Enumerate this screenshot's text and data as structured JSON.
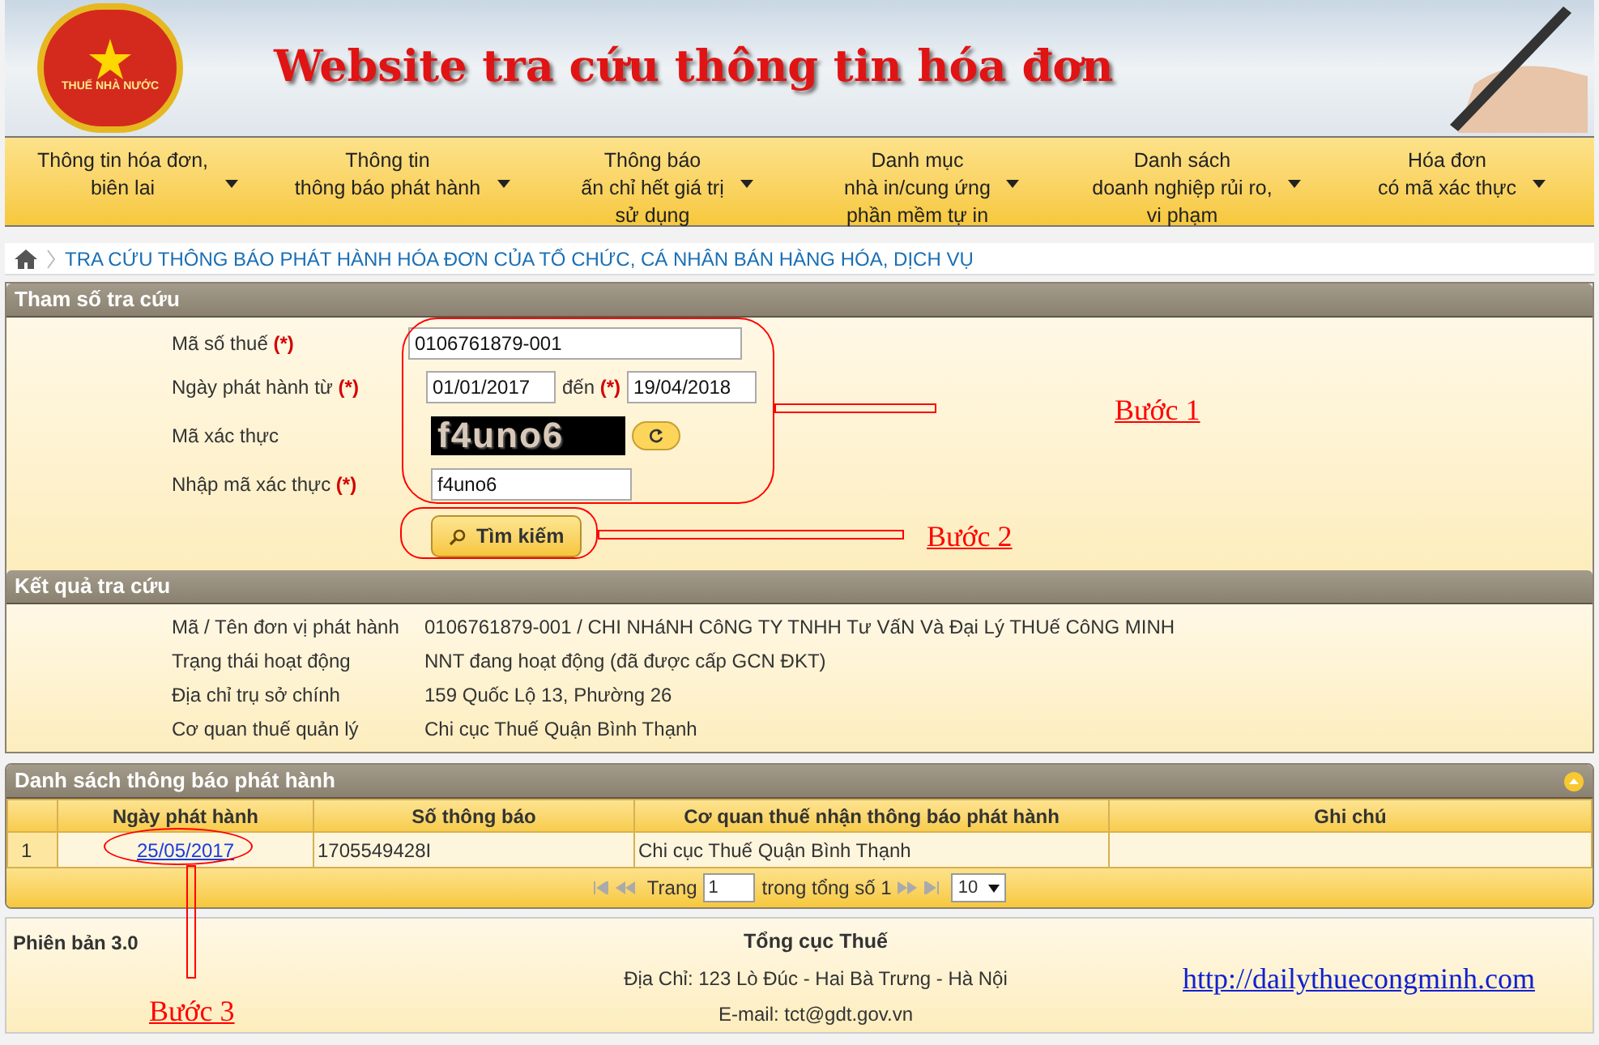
{
  "header": {
    "emblem_text": "THUẾ NHÀ NƯỚC",
    "title": "Website tra cứu thông tin hóa đơn"
  },
  "menu": [
    {
      "lines": [
        "Thông tin hóa đơn,",
        "biên lai"
      ]
    },
    {
      "lines": [
        "Thông tin",
        "thông báo phát hành"
      ]
    },
    {
      "lines": [
        "Thông báo",
        "ấn chỉ hết giá trị",
        "sử dụng"
      ]
    },
    {
      "lines": [
        "Danh mục",
        "nhà in/cung ứng",
        "phần mềm tự in"
      ]
    },
    {
      "lines": [
        "Danh sách",
        "doanh nghiệp rủi ro,",
        "vi phạm"
      ]
    },
    {
      "lines": [
        "Hóa đơn",
        "có mã xác thực"
      ]
    }
  ],
  "breadcrumb": "TRA CỨU THÔNG BÁO PHÁT HÀNH HÓA ĐƠN CỦA TỔ CHỨC, CÁ NHÂN BÁN HÀNG HÓA, DỊCH VỤ",
  "search": {
    "title": "Tham số tra cứu",
    "required_mark": "(*)",
    "tax_code_label": "Mã số thuế",
    "tax_code": "0106761879-001",
    "date_label": "Ngày phát hành từ",
    "date_from": "01/01/2017",
    "to_label": "đến",
    "date_to": "19/04/2018",
    "captcha_label": "Mã xác thực",
    "captcha": "f4uno6",
    "captcha_input_label": "Nhập mã xác thực",
    "captcha_input": "f4uno6",
    "button": "Tìm kiếm"
  },
  "result": {
    "title": "Kết quả tra cứu",
    "rows": [
      {
        "label": "Mã / Tên đơn vị phát hành",
        "value": "0106761879-001 / CHI NHáNH CôNG TY TNHH Tư VấN Và Đại Lý THUế CôNG MINH"
      },
      {
        "label": "Trạng thái hoạt động",
        "value": "NNT đang hoạt động (đã được cấp GCN ĐKT)"
      },
      {
        "label": "Địa chỉ trụ sở chính",
        "value": "159 Quốc Lộ 13, Phường 26"
      },
      {
        "label": "Cơ quan thuế quản lý",
        "value": "Chi cục Thuế Quận Bình Thạnh"
      }
    ]
  },
  "notices": {
    "title": "Danh sách thông báo phát hành",
    "columns": [
      "Ngày phát hành",
      "Số thông báo",
      "Cơ quan thuế nhận thông báo phát hành",
      "Ghi chú"
    ],
    "rows": [
      {
        "index": "1",
        "date": "25/05/2017",
        "number": "1705549428I",
        "agency": "Chi cục Thuế Quận Bình Thạnh"
      }
    ],
    "pager": {
      "page_label": "Trang",
      "page": "1",
      "total_label": "trong tổng số 1",
      "page_size": "10"
    }
  },
  "footer": {
    "version": "Phiên bản 3.0",
    "org": "Tổng cục Thuế",
    "address": "Địa Chỉ: 123 Lò Đúc - Hai Bà Trưng - Hà Nội",
    "email": "E-mail: tct@gdt.gov.vn",
    "link": "http://dailythuecongminh.com"
  },
  "annotations": [
    {
      "label": "Bước 1"
    },
    {
      "label": "Bước 2"
    },
    {
      "label": "Bước 3"
    }
  ]
}
